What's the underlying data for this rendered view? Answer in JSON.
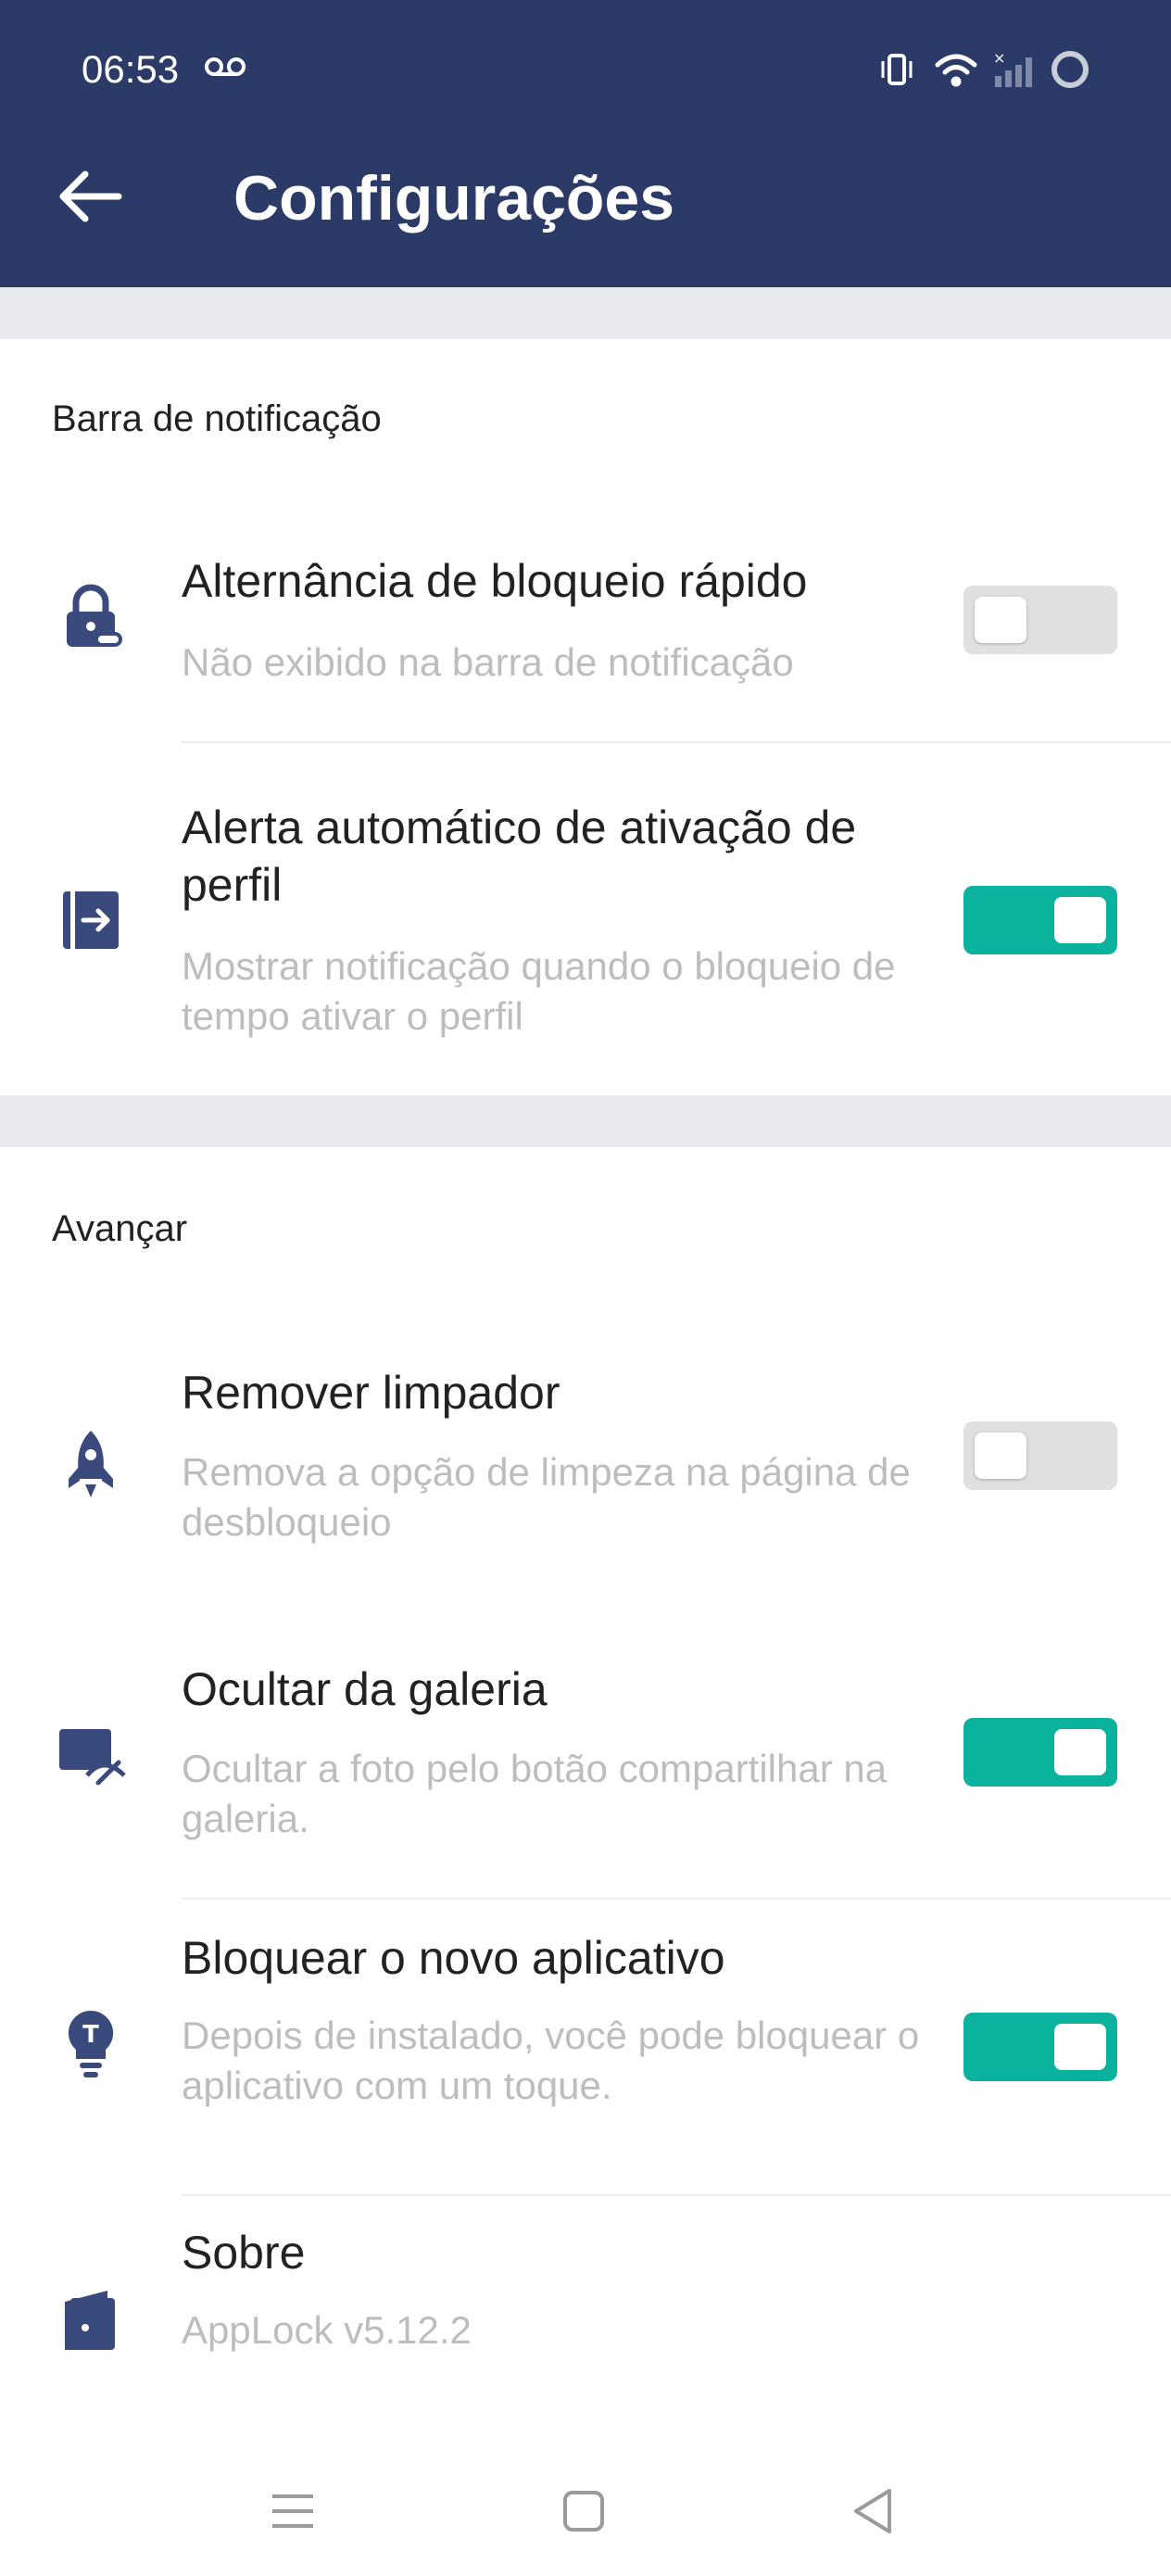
{
  "status_bar": {
    "time": "06:53"
  },
  "header": {
    "title": "Configurações"
  },
  "sections": [
    {
      "label": "Barra de notificação",
      "items": [
        {
          "title": "Alternância de bloqueio rápido",
          "description": "Não exibido na barra de notificação",
          "icon": "lock-icon",
          "enabled": false
        },
        {
          "title": "Alerta automático de ativação de perfil",
          "description": "Mostrar notificação quando o bloqueio de tempo ativar o perfil",
          "icon": "profile-enter-icon",
          "enabled": true
        }
      ]
    },
    {
      "label": "Avançar",
      "items": [
        {
          "title": "Remover limpador",
          "description": "Remova a opção de limpeza na página de desbloqueio",
          "icon": "rocket-icon",
          "enabled": false
        },
        {
          "title": "Ocultar da galeria",
          "description": "Ocultar a foto pelo botão compartilhar na galeria.",
          "icon": "hidden-image-icon",
          "enabled": true
        },
        {
          "title": "Bloquear o novo aplicativo",
          "description": "Depois de instalado, você pode bloquear o aplicativo com um toque.",
          "icon": "lightbulb-icon",
          "enabled": true
        },
        {
          "title": "Sobre",
          "description": "AppLock v5.12.2",
          "icon": "door-icon"
        }
      ]
    }
  ],
  "colors": {
    "header": "#2b3a67",
    "accent": "#0bb39e",
    "icon": "#3b4a7c",
    "toggle_off": "#e0e0e0"
  }
}
